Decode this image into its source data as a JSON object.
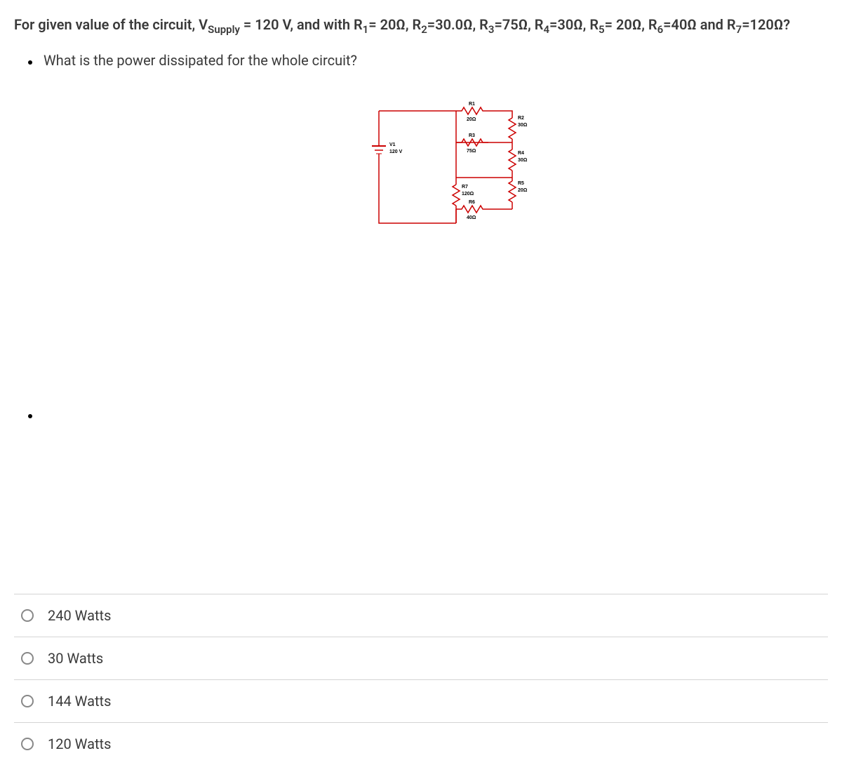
{
  "question": {
    "prefix": "For given value of the circuit,  V",
    "supply_sub": "Supply",
    "mid1": " = 120 V, and with R",
    "r1_sub": "1",
    "mid2": "= 20Ω, R",
    "r2_sub": "2",
    "mid3": "=30.0Ω, R",
    "r3_sub": "3",
    "mid4": "=75Ω, R",
    "r4_sub": "4",
    "mid5": "=30Ω, R",
    "r5_sub": "5",
    "mid6": "= 20Ω, R",
    "r6_sub": "6",
    "mid7": "=40Ω and R",
    "r7_sub": "7",
    "mid8": "=120Ω?"
  },
  "sub_question": "What is the power dissipated for the whole circuit?",
  "circuit": {
    "v1_label": "V1",
    "v1_value": "120 V",
    "r1_label": "R1",
    "r1_value": "20Ω",
    "r2_label": "R2",
    "r2_value": "30Ω",
    "r3_label": "R3",
    "r3_value": "75Ω",
    "r4_label": "R4",
    "r4_value": "30Ω",
    "r5_label": "R5",
    "r5_value": "20Ω",
    "r6_label": "R6",
    "r6_value": "40Ω",
    "r7_label": "R7",
    "r7_value": "120Ω"
  },
  "options": [
    "240 Watts",
    "30 Watts",
    "144 Watts",
    "120 Watts"
  ]
}
